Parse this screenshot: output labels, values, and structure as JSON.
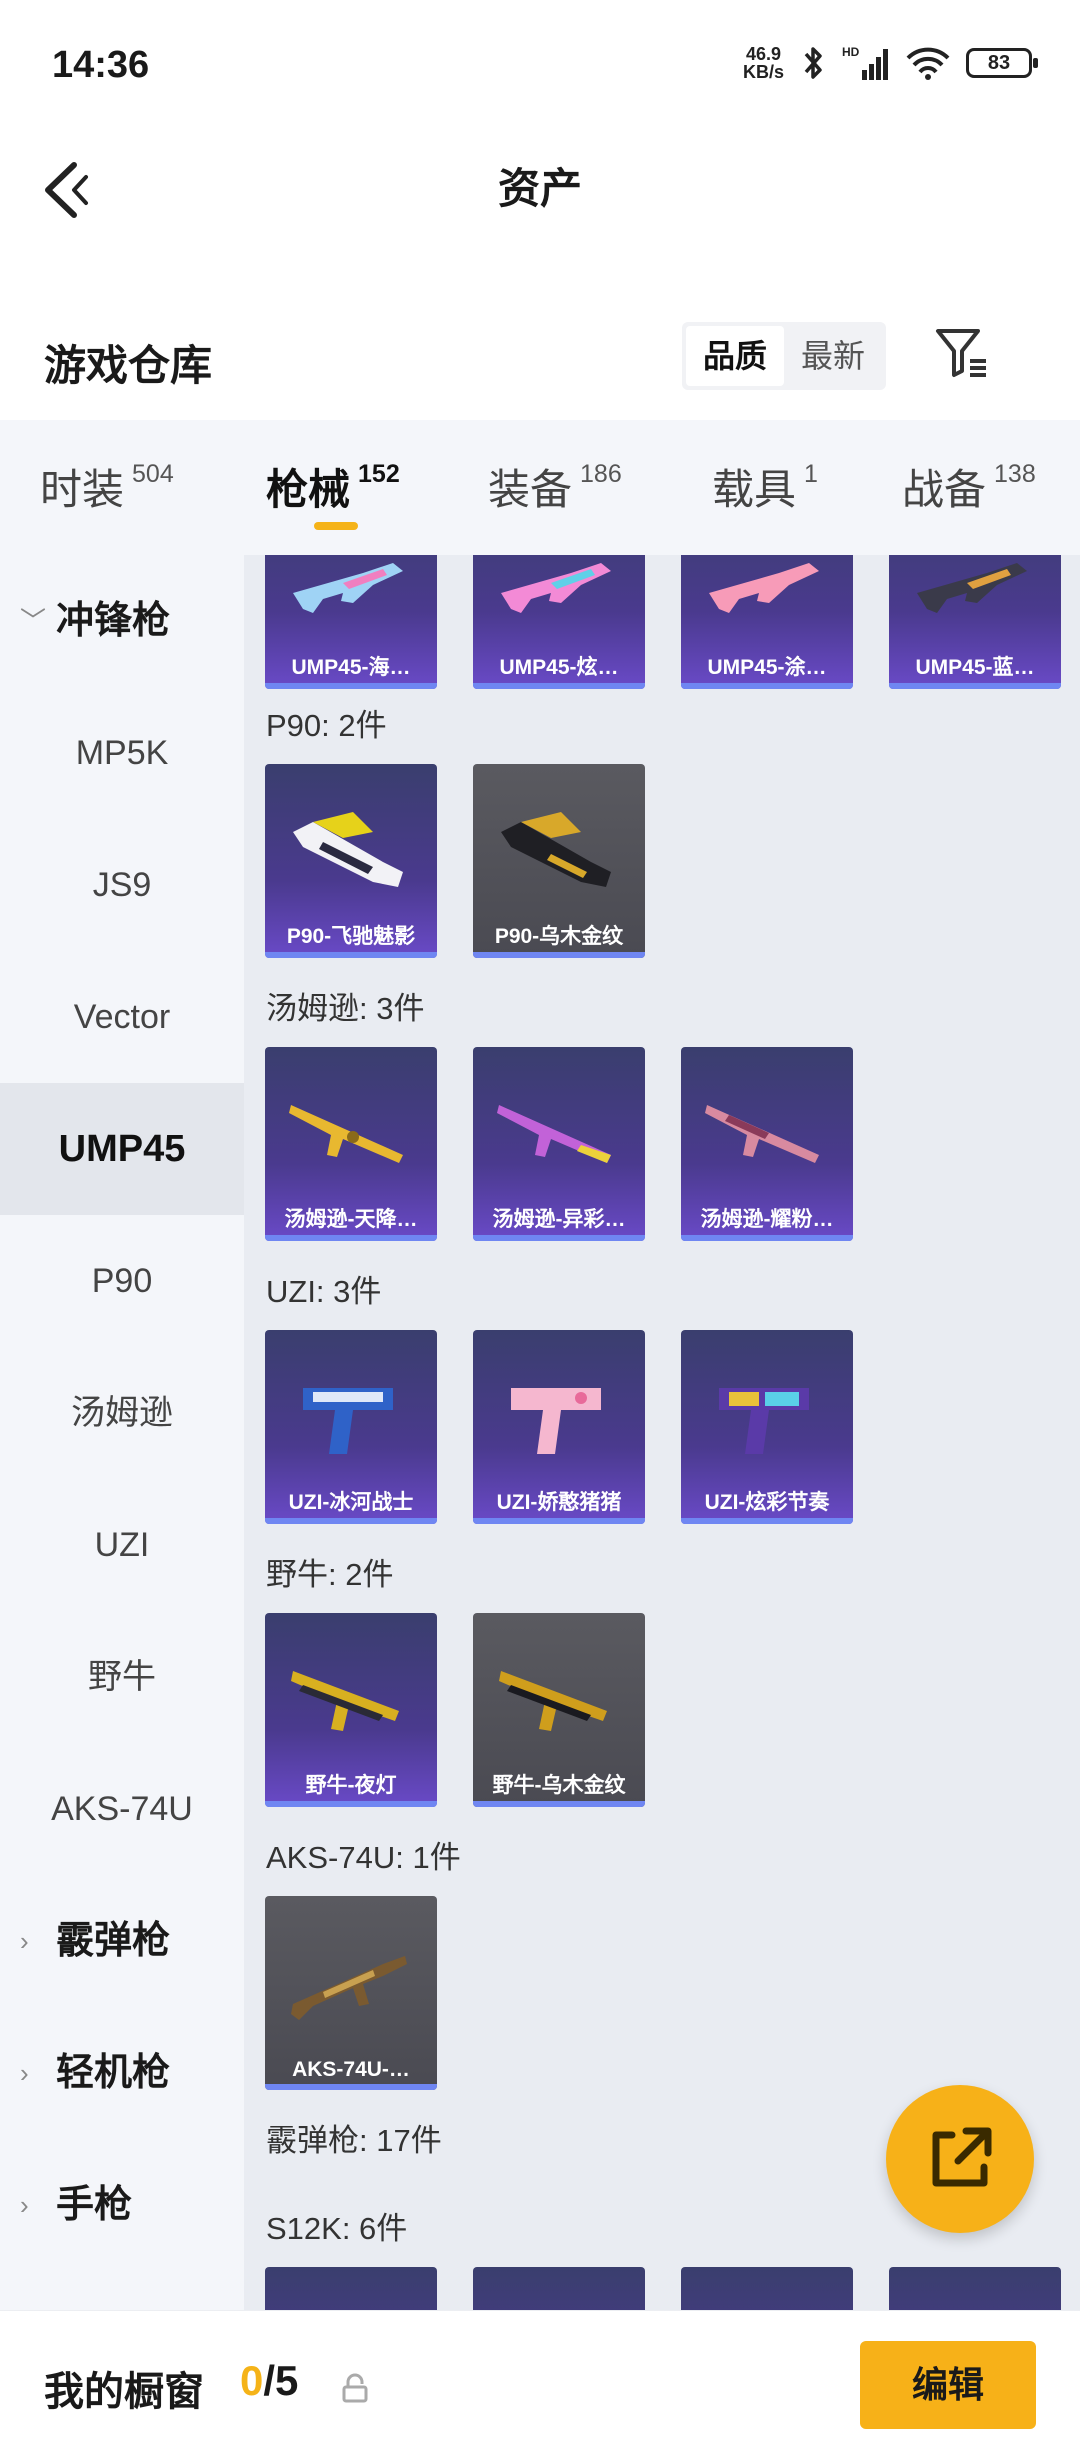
{
  "status": {
    "time": "14:36",
    "net_speed_top": "46.9",
    "net_speed_bottom": "KB/s",
    "battery": "83"
  },
  "header": {
    "title": "资产"
  },
  "warehouse": {
    "title": "游戏仓库",
    "sort_quality": "品质",
    "sort_latest": "最新"
  },
  "tabs": [
    {
      "label": "时装",
      "count": "504"
    },
    {
      "label": "枪械",
      "count": "152"
    },
    {
      "label": "装备",
      "count": "186"
    },
    {
      "label": "载具",
      "count": "1"
    },
    {
      "label": "战备",
      "count": "138"
    }
  ],
  "sidebar": {
    "group_smg": "冲锋枪",
    "items": [
      "MP5K",
      "JS9",
      "Vector",
      "UMP45",
      "P90",
      "汤姆逊",
      "UZI",
      "野牛",
      "AKS-74U"
    ],
    "group_shotgun": "霰弹枪",
    "group_lmg": "轻机枪",
    "group_pistol": "手枪"
  },
  "content": {
    "top_row": [
      "UMP45-海…",
      "UMP45-炫…",
      "UMP45-涂…",
      "UMP45-蓝…"
    ],
    "p90_label": "P90: 2件",
    "p90": [
      "P90-飞驰魅影",
      "P90-乌木金纹"
    ],
    "thompson_label": "汤姆逊: 3件",
    "thompson": [
      "汤姆逊-天降…",
      "汤姆逊-异彩…",
      "汤姆逊-耀粉…"
    ],
    "uzi_label": "UZI: 3件",
    "uzi": [
      "UZI-冰河战士",
      "UZI-娇憨猪猪",
      "UZI-炫彩节奏"
    ],
    "bison_label": "野牛: 2件",
    "bison": [
      "野牛-夜灯",
      "野牛-乌木金纹"
    ],
    "aks_label": "AKS-74U: 1件",
    "aks": [
      "AKS-74U-…"
    ],
    "shotgun_label": "霰弹枪: 17件",
    "s12k_label": "S12K: 6件"
  },
  "bottom": {
    "showcase_title": "我的橱窗",
    "showcase_current": "0",
    "showcase_total": "/5",
    "edit_label": "编辑"
  }
}
